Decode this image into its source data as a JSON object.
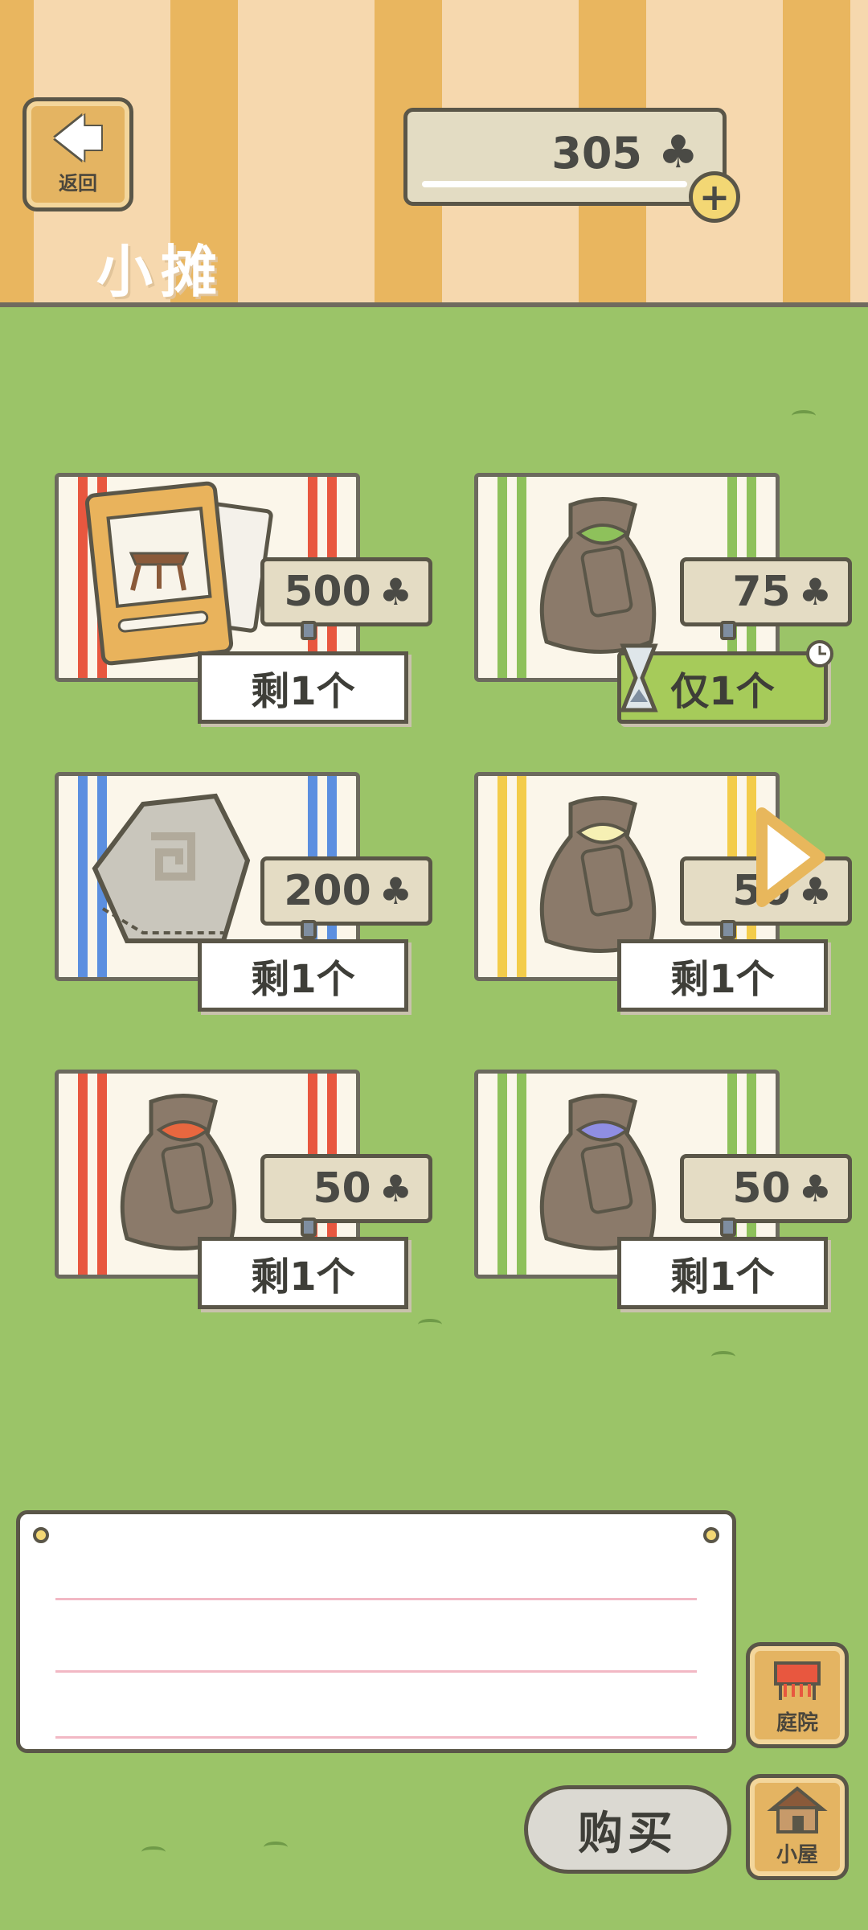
{
  "header": {
    "back_label": "返回",
    "title": "小摊",
    "currency_value": "305",
    "currency_icon": "clover-icon",
    "plus_label": "+"
  },
  "colors": {
    "background_grass": "#9bc468",
    "header_stripe_dark": "#e9b65f",
    "header_stripe_light": "#f6d8ae",
    "limited_badge": "#a6cb5a"
  },
  "items": [
    {
      "name": "card",
      "price": "500",
      "stock": "剩1个",
      "stripe_color": "#e8573f",
      "limited": false
    },
    {
      "name": "seed-bag-green",
      "price": "75",
      "stock": "仅1个",
      "stripe_color": "#8ec15b",
      "limited": true
    },
    {
      "name": "stone",
      "price": "200",
      "stock": "剩1个",
      "stripe_color": "#5b8fe0",
      "limited": false
    },
    {
      "name": "seed-bag-yellow",
      "price": "50",
      "stock": "剩1个",
      "stripe_color": "#f3cc4a",
      "limited": false
    },
    {
      "name": "seed-bag-red",
      "price": "50",
      "stock": "剩1个",
      "stripe_color": "#e8573f",
      "limited": false
    },
    {
      "name": "seed-bag-blue",
      "price": "50",
      "stock": "剩1个",
      "stripe_color": "#8ec15b",
      "limited": false
    }
  ],
  "side_buttons": {
    "yard_label": "庭院",
    "house_label": "小屋"
  },
  "buy_label": "购买",
  "clover_glyph": "♣"
}
